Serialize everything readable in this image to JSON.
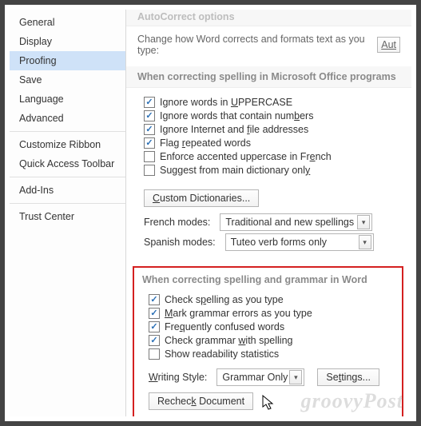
{
  "sidebar": {
    "items": [
      {
        "label": "General"
      },
      {
        "label": "Display"
      },
      {
        "label": "Proofing"
      },
      {
        "label": "Save"
      },
      {
        "label": "Language"
      },
      {
        "label": "Advanced"
      },
      {
        "label": "Customize Ribbon"
      },
      {
        "label": "Quick Access Toolbar"
      },
      {
        "label": "Add-Ins"
      },
      {
        "label": "Trust Center"
      }
    ],
    "selected_index": 2,
    "separators_after": [
      5,
      7,
      8
    ]
  },
  "autocorrect": {
    "heading": "AutoCorrect options",
    "intro": "Change how Word corrects and formats text as you type:",
    "button_partial": "Aut"
  },
  "office_section": {
    "heading": "When correcting spelling in Microsoft Office programs",
    "checks": [
      {
        "checked": true,
        "pre": "Ignore words in ",
        "u": "U",
        "post": "PPERCASE"
      },
      {
        "checked": true,
        "pre": "Ignore words that contain num",
        "u": "b",
        "post": "ers"
      },
      {
        "checked": true,
        "pre": "Ignore Internet and ",
        "u": "f",
        "post": "ile addresses"
      },
      {
        "checked": true,
        "pre": "Flag ",
        "u": "r",
        "post": "epeated words"
      },
      {
        "checked": false,
        "pre": "Enforce accented uppercase in Fr",
        "u": "e",
        "post": "nch"
      },
      {
        "checked": false,
        "pre": "Suggest from main dictionary onl",
        "u": "y",
        "post": ""
      }
    ],
    "dict_button_pre": "",
    "dict_button_u": "C",
    "dict_button_post": "ustom Dictionaries...",
    "french_label": "French modes:",
    "french_value": "Traditional and new spellings",
    "spanish_label": "Spanish modes:",
    "spanish_value": "Tuteo verb forms only"
  },
  "word_section": {
    "heading": "When correcting spelling and grammar in Word",
    "checks": [
      {
        "checked": true,
        "pre": "Check s",
        "u": "p",
        "post": "elling as you type"
      },
      {
        "checked": true,
        "pre": "",
        "u": "M",
        "post": "ark grammar errors as you type"
      },
      {
        "checked": true,
        "pre": "Fre",
        "u": "q",
        "post": "uently confused words"
      },
      {
        "checked": true,
        "pre": "Check grammar ",
        "u": "w",
        "post": "ith spelling"
      },
      {
        "checked": false,
        "pre": "Show readability statistics",
        "u": "",
        "post": ""
      }
    ],
    "writing_style_label_pre": "",
    "writing_style_label_u": "W",
    "writing_style_label_post": "riting Style:",
    "writing_style_value": "Grammar Only",
    "settings_button_pre": "Se",
    "settings_button_u": "t",
    "settings_button_post": "tings...",
    "recheck_button_pre": "Rechec",
    "recheck_button_u": "k",
    "recheck_button_post": " Document"
  },
  "watermark": "groovyPost"
}
